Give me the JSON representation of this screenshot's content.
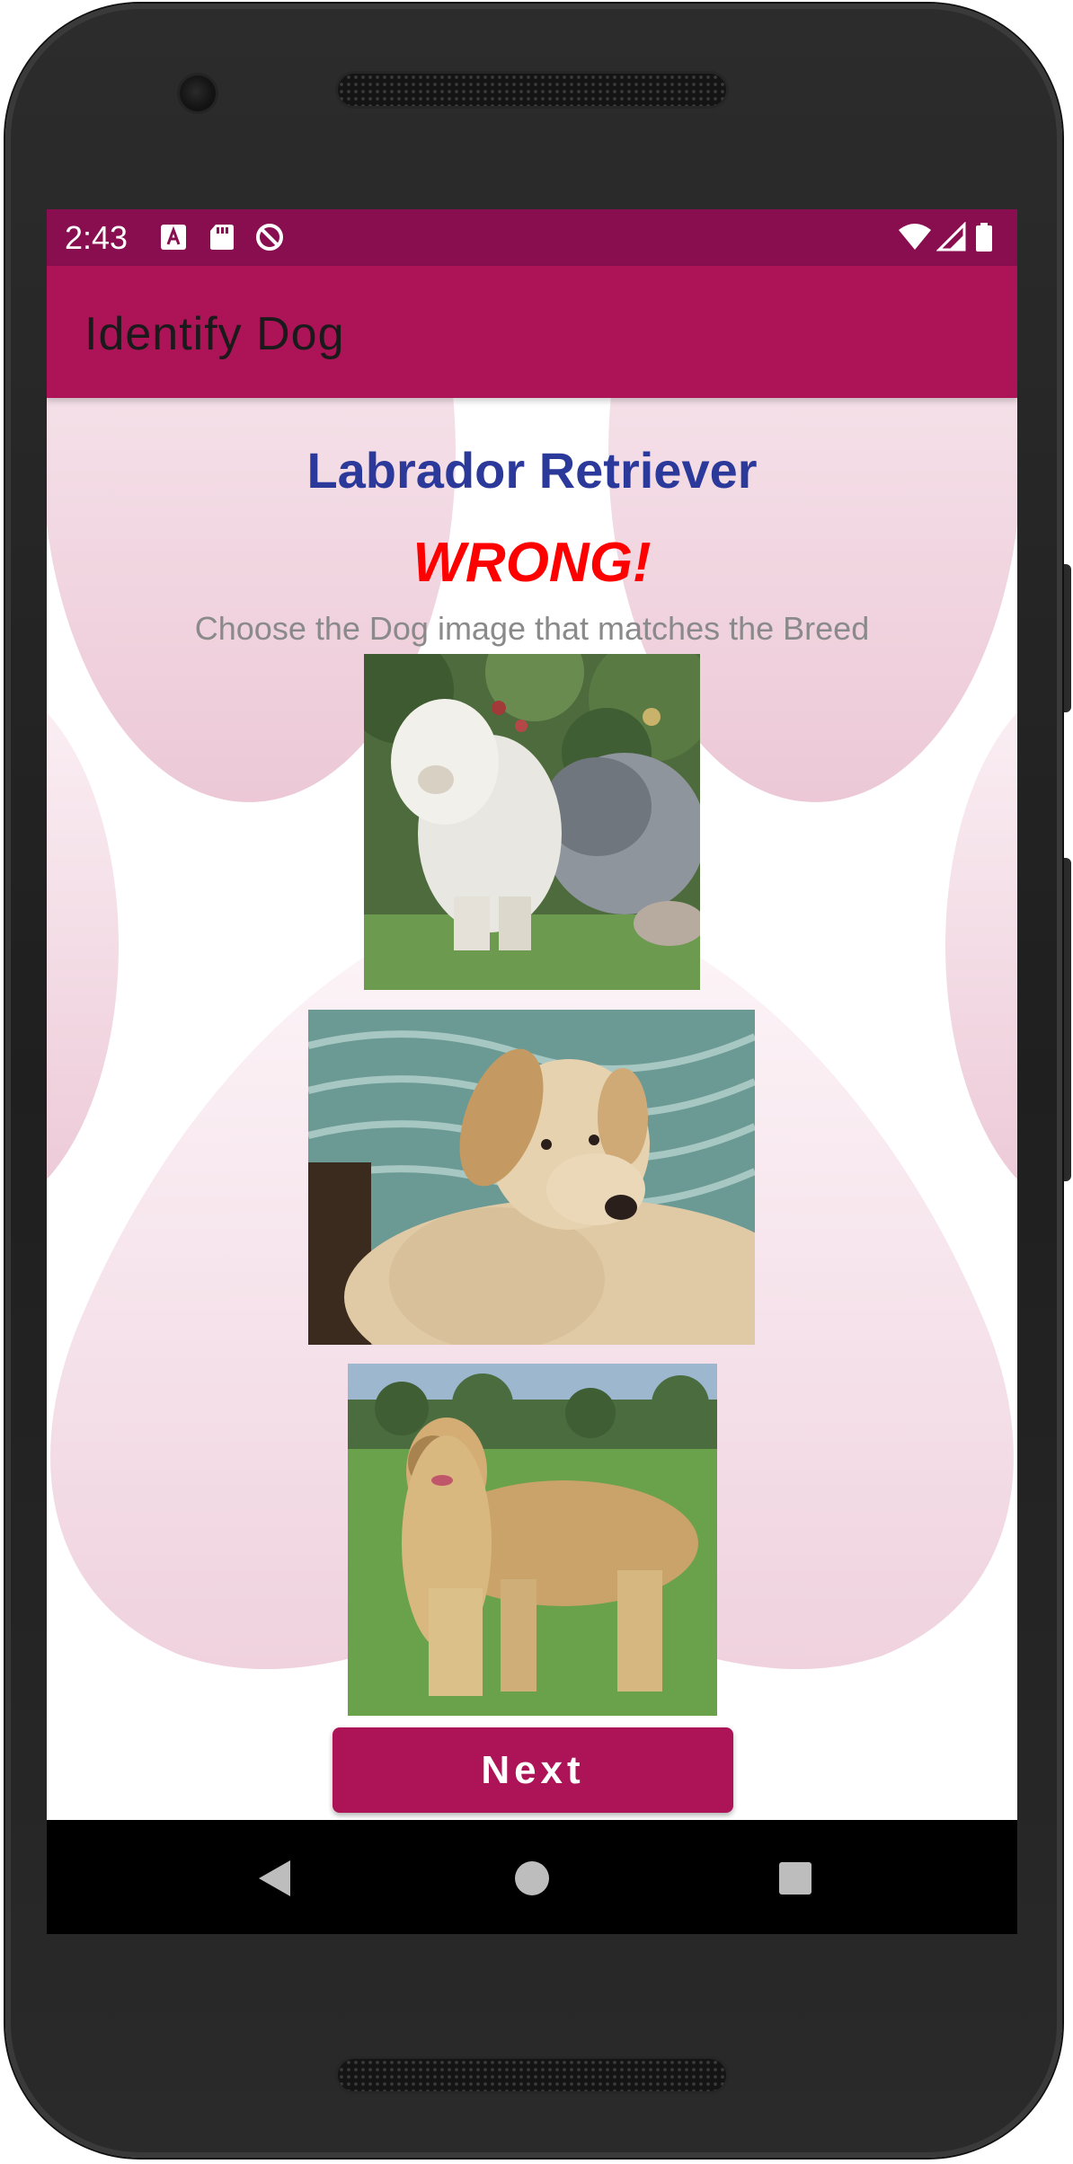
{
  "status_bar": {
    "time": "2:43",
    "left_icons": [
      "font-download-icon",
      "sd-card-icon",
      "do-not-disturb-icon"
    ],
    "right_icons": [
      "wifi-icon",
      "cellular-signal-icon",
      "battery-icon"
    ],
    "background": "#880e4f"
  },
  "app_bar": {
    "title": "Identify Dog",
    "background": "#ad1457"
  },
  "quiz": {
    "breed_name": "Labrador Retriever",
    "result": "WRONG!",
    "instruction": "Choose the Dog image that matches the Breed",
    "options": [
      {
        "depicts": "Old English Sheepdog"
      },
      {
        "depicts": "Labrador Retriever"
      },
      {
        "depicts": "Afghan Hound"
      }
    ],
    "next_label": "Next",
    "colors": {
      "breed_name": "#2b3a9a",
      "result": "#ff0000",
      "instruction": "#8a8a8a",
      "button": "#ad1457"
    }
  },
  "nav_bar": {
    "buttons": [
      "back-icon",
      "home-icon",
      "recents-icon"
    ]
  }
}
